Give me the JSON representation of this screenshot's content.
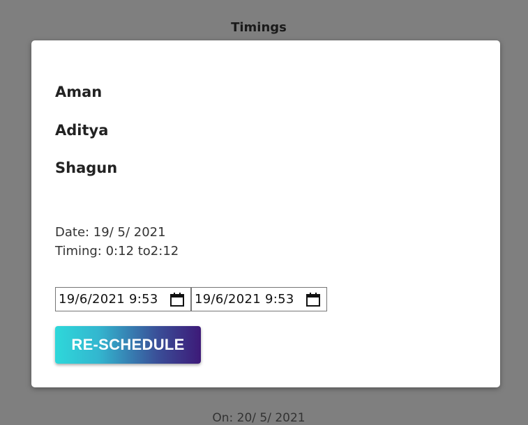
{
  "header": {
    "title": "Timings"
  },
  "modal": {
    "names": [
      "Aman",
      "Aditya",
      "Shagun"
    ],
    "date_text": "Date: 19/ 5/ 2021",
    "timing_text": "Timing: 0:12 to2:12",
    "start_input": {
      "value": "19/6/2021  9:53"
    },
    "end_input": {
      "value": "19/6/2021  9:53"
    },
    "reschedule_label": "RE-SCHEDULE"
  },
  "footer": {
    "text": "On: 20/ 5/ 2021"
  },
  "colors": {
    "overlay": "#7f7f7f",
    "button_gradient_start": "#2ed8da",
    "button_gradient_end": "#3d1a78"
  }
}
